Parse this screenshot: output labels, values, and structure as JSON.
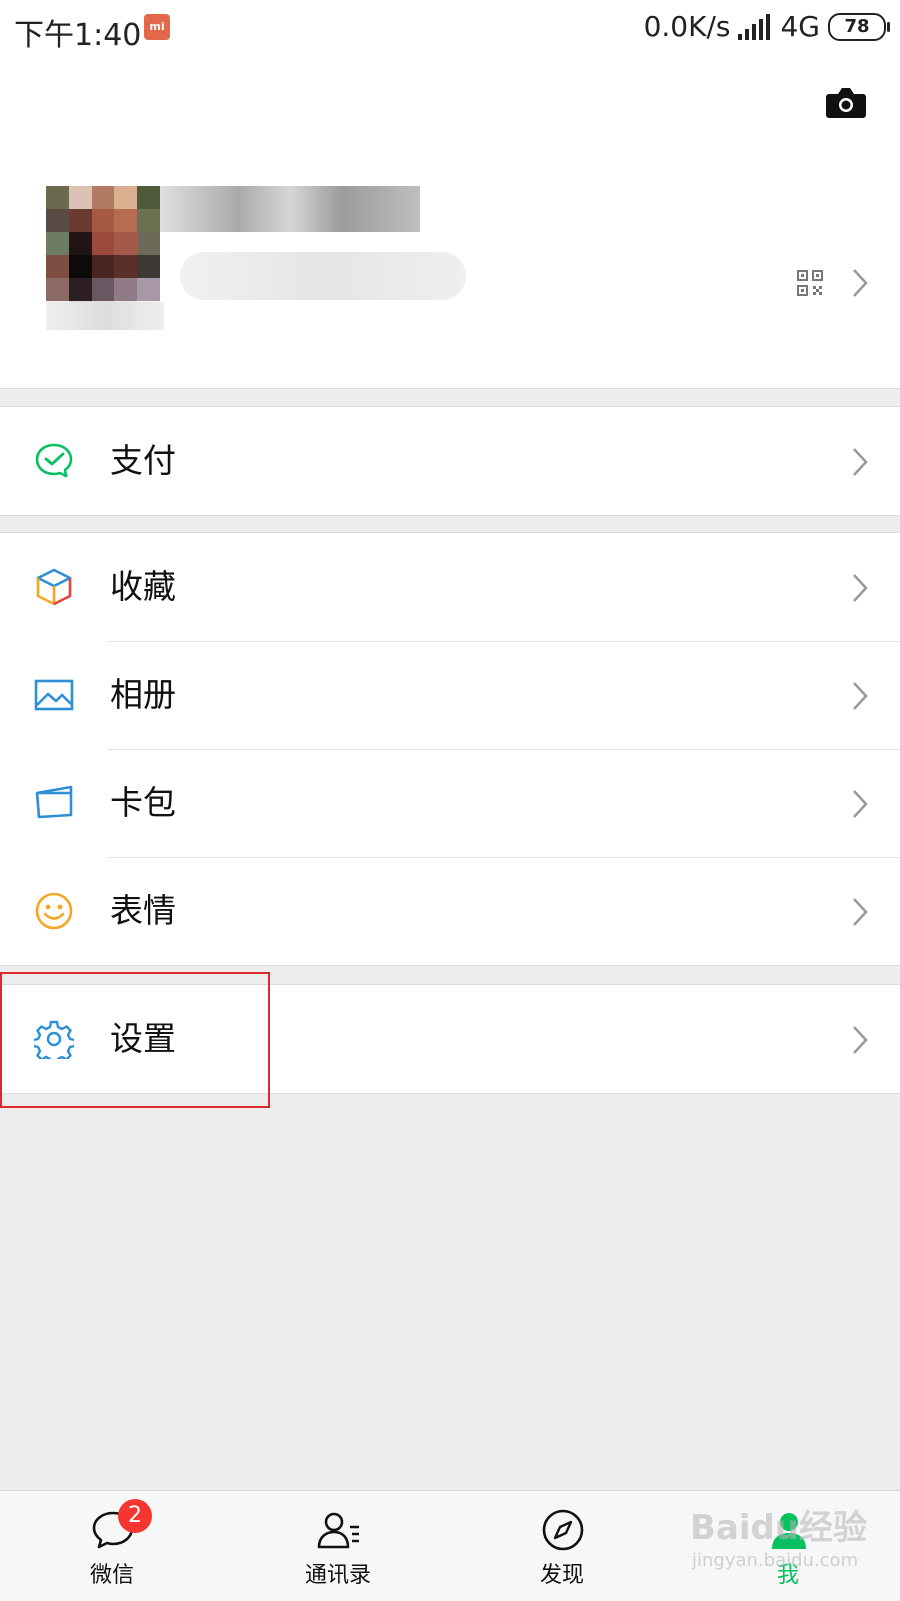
{
  "status_bar": {
    "time": "下午1:40",
    "carrier_badge": "mi",
    "net_speed": "0.0K/s",
    "network": "4G",
    "battery": "78"
  },
  "profile": {
    "camera_icon": "camera-icon",
    "qr_icon": "qrcode-icon"
  },
  "groups": {
    "pay": {
      "label": "支付",
      "icon": "wechat-pay-icon",
      "color": "#07c160"
    },
    "favorites": {
      "label": "收藏",
      "icon": "cube-icon"
    },
    "album": {
      "label": "相册",
      "icon": "picture-icon",
      "color": "#2d8fd6"
    },
    "cards": {
      "label": "卡包",
      "icon": "card-wallet-icon",
      "color": "#2d8fd6"
    },
    "stickers": {
      "label": "表情",
      "icon": "smiley-icon",
      "color": "#f5a623"
    },
    "settings": {
      "label": "设置",
      "icon": "gear-icon",
      "color": "#2d8fd6"
    }
  },
  "tabbar": {
    "chats": {
      "label": "微信",
      "badge": "2"
    },
    "contacts": {
      "label": "通讯录"
    },
    "discover": {
      "label": "发现"
    },
    "me": {
      "label": "我",
      "color": "#07c160"
    }
  },
  "watermark": {
    "text": "Baidu经验",
    "sub": "jingyan.baidu.com"
  },
  "colors": {
    "accent": "#07c160",
    "badge": "#f43530",
    "highlight": "#e02a2a"
  }
}
